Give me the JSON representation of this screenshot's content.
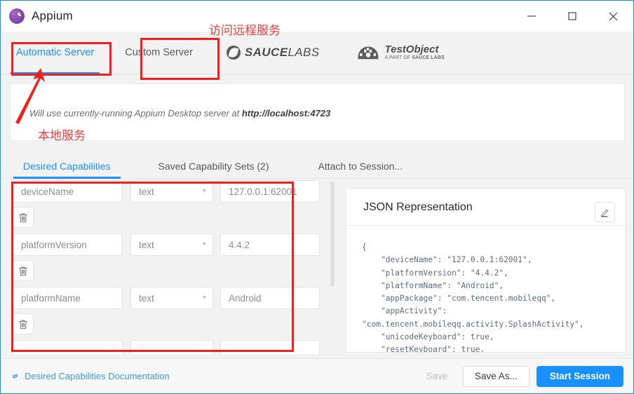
{
  "window": {
    "title": "Appium",
    "logo_icon": "appium-logo-icon",
    "controls": {
      "minimize_icon": "minimize-icon",
      "maximize_icon": "maximize-icon",
      "close_icon": "close-icon"
    }
  },
  "server_tabs": [
    {
      "label": "Automatic Server",
      "active": true
    },
    {
      "label": "Custom Server",
      "active": false
    }
  ],
  "brands": {
    "sauce_bold": "SAUCE",
    "sauce_light": "LABS",
    "testobject_name": "TestObject",
    "testobject_sub_prefix": "A PART OF ",
    "testobject_sub_brand": "SAUCE LABS"
  },
  "info_card": {
    "message_prefix": "Will use currently-running Appium Desktop server at ",
    "message_url": "http://localhost:4723"
  },
  "inner_tabs": [
    {
      "label": "Desired Capabilities",
      "active": true
    },
    {
      "label": "Saved Capability Sets (2)",
      "active": false
    },
    {
      "label": "Attach to Session...",
      "active": false
    }
  ],
  "capabilities": [
    {
      "name": "deviceName",
      "type": "text",
      "value": "127.0.0.1:62001",
      "delete_icon": "trash-icon"
    },
    {
      "name": "platformVersion",
      "type": "text",
      "value": "4.4.2",
      "delete_icon": "trash-icon"
    },
    {
      "name": "platformName",
      "type": "text",
      "value": "Android",
      "delete_icon": "trash-icon"
    }
  ],
  "capability_field_labels": {
    "chevron": "⌄",
    "dropdown_icon": "chevron-down-icon"
  },
  "json_panel": {
    "title": "JSON Representation",
    "edit_icon": "pencil-edit-icon",
    "content": "{\n    \"deviceName\": \"127.0.0.1:62001\",\n    \"platformVersion\": \"4.4.2\",\n    \"platformName\": \"Android\",\n    \"appPackage\": \"com.tencent.mobileqq\",\n    \"appActivity\":\n\"com.tencent.mobileqq.activity.SplashActivity\",\n    \"unicodeKeyboard\": true,\n    \"resetKeyboard\": true,"
  },
  "footer": {
    "doc_link": "Desired Capabilities Documentation",
    "doc_link_icon": "link-icon",
    "save_label": "Save",
    "save_as_label": "Save As...",
    "start_session_label": "Start Session"
  },
  "annotations": {
    "remote_note": "访问远程服务",
    "local_note": "本地服务",
    "color": "#ef2020",
    "arrow_icon": "arrow-pointer-icon"
  }
}
